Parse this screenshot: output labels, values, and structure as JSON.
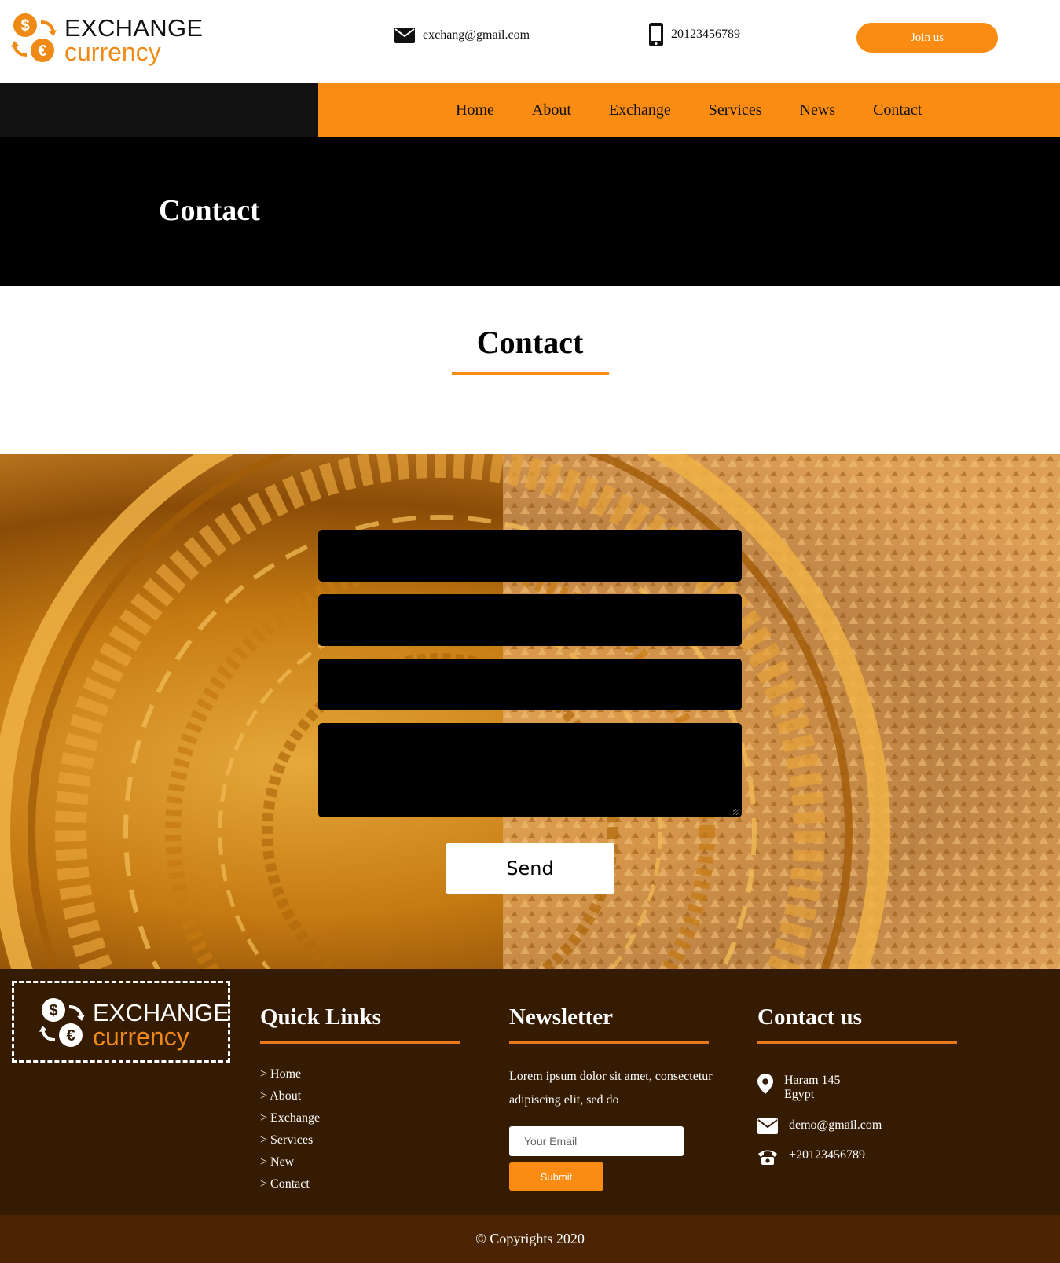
{
  "brand": {
    "word1": "EXCHANGE",
    "word2": "currency",
    "colors": {
      "accent": "#fb8c13",
      "dark": "#111111",
      "footer": "#351b02",
      "copyright_bar": "#4b2503"
    }
  },
  "header": {
    "email": "exchang@gmail.com",
    "phone": "20123456789",
    "join_label": "Join us"
  },
  "nav": {
    "items": [
      {
        "label": "Home"
      },
      {
        "label": "About"
      },
      {
        "label": "Exchange"
      },
      {
        "label": "Services"
      },
      {
        "label": "News"
      },
      {
        "label": "Contact"
      }
    ]
  },
  "banner": {
    "title": "Contact"
  },
  "section": {
    "title": "Contact"
  },
  "form": {
    "send_label": "Send"
  },
  "footer": {
    "quick_links": {
      "title": "Quick Links",
      "items": [
        "> Home",
        "> About",
        "> Exchange",
        "> Services",
        "> New",
        "> Contact"
      ]
    },
    "newsletter": {
      "title": "Newsletter",
      "text": "Lorem ipsum dolor sit amet, consectetur adipiscing elit, sed do",
      "email_placeholder": "Your Email",
      "submit_label": "Submit"
    },
    "contact": {
      "title": "Contact us",
      "address_line1": "Haram 145",
      "address_line2": "Egypt",
      "email": "demo@gmail.com",
      "phone": "+20123456789"
    },
    "copyright": "© Copyrights 2020"
  },
  "icons": {
    "logo": "currency-exchange-icon",
    "email": "envelope-icon",
    "phone": "smartphone-icon",
    "location": "map-pin-icon",
    "telephone": "telephone-icon"
  }
}
